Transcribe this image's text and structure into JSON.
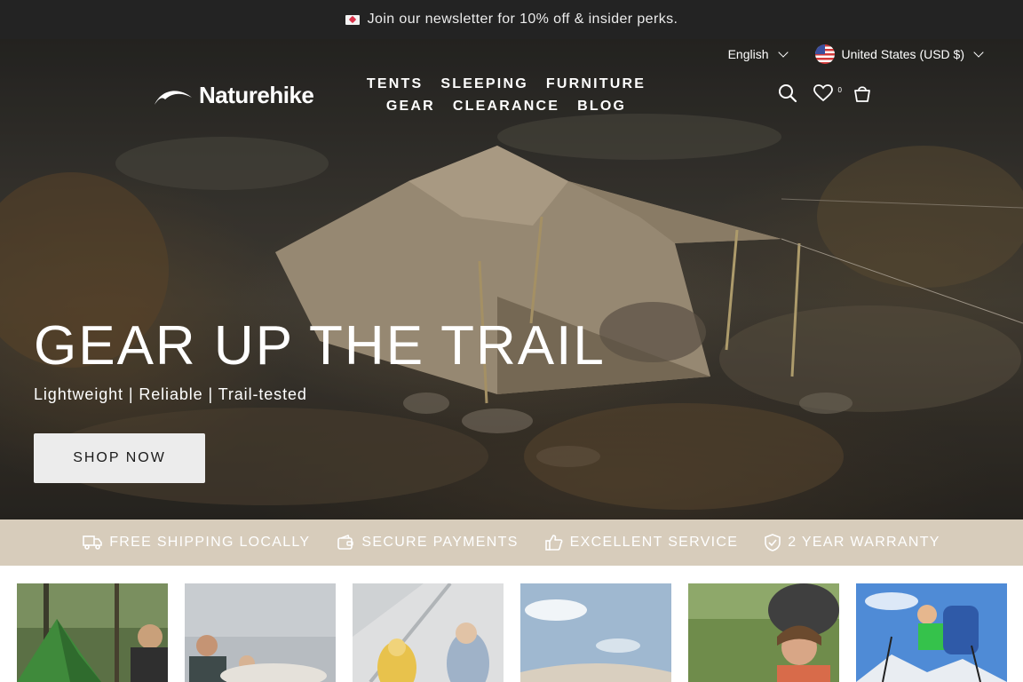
{
  "announcement": {
    "text": "Join our newsletter for 10% off & insider perks.",
    "icon": "envelope-heart-icon"
  },
  "utility": {
    "language": "English",
    "currency": "United States (USD $)",
    "flag_icon": "us-flag-icon"
  },
  "brand": {
    "name": "Naturehike"
  },
  "nav": {
    "items": [
      "TENTS",
      "SLEEPING",
      "FURNITURE",
      "GEAR",
      "CLEARANCE",
      "BLOG"
    ]
  },
  "header_icons": {
    "search": "search-icon",
    "wishlist": "heart-icon",
    "wishlist_count": "0",
    "cart": "bag-icon"
  },
  "hero": {
    "title": "GEAR UP THE TRAIL",
    "subtitle": "Lightweight | Reliable | Trail-tested",
    "cta": "SHOP NOW"
  },
  "features": [
    {
      "label": "FREE SHIPPING LOCALLY",
      "icon": "truck-icon"
    },
    {
      "label": "SECURE PAYMENTS",
      "icon": "wallet-icon"
    },
    {
      "label": "EXCELLENT SERVICE",
      "icon": "thumbs-up-icon"
    },
    {
      "label": "2 YEAR WARRANTY",
      "icon": "shield-check-icon"
    }
  ],
  "colors": {
    "announce_bg": "#232323",
    "features_bg": "#d7ccbb",
    "cta_bg": "#ececec"
  }
}
